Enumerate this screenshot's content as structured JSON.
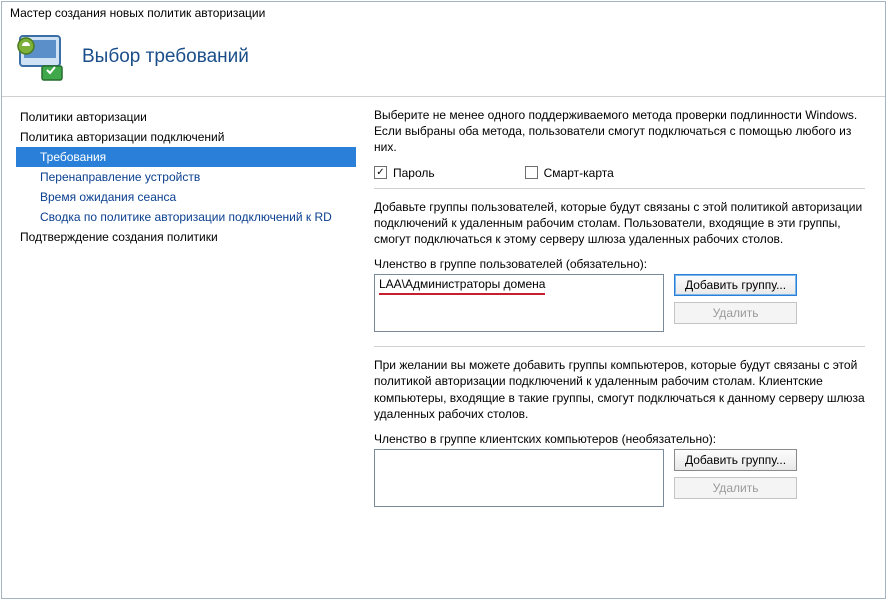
{
  "titlebar": "Мастер создания новых политик авторизации",
  "header": {
    "title": "Выбор требований"
  },
  "nav": {
    "items": [
      {
        "label": "Политики авторизации",
        "sub": false
      },
      {
        "label": "Политика авторизации подключений",
        "sub": false
      },
      {
        "label": "Требования",
        "sub": true,
        "selected": true
      },
      {
        "label": "Перенаправление устройств",
        "sub": true
      },
      {
        "label": "Время ожидания сеанса",
        "sub": true
      },
      {
        "label": "Сводка по политике авторизации подключений к RD",
        "sub": true
      },
      {
        "label": "Подтверждение создания политики",
        "sub": false
      }
    ]
  },
  "content": {
    "intro": "Выберите не менее одного поддерживаемого метода проверки подлинности Windows. Если выбраны оба метода, пользователи смогут подключаться с помощью любого из них.",
    "checkbox_password": "Пароль",
    "checkbox_smartcard": "Смарт-карта",
    "users_section_text": "Добавьте группы пользователей, которые будут связаны с этой политикой авторизации подключений к удаленным рабочим столам. Пользователи, входящие в эти группы, смогут подключаться к этому серверу шлюза удаленных рабочих столов.",
    "users_label": "Членство в группе пользователей (обязательно):",
    "users_entry": "LAA\\Администраторы домена",
    "computers_section_text": "При желании вы можете добавить группы компьютеров, которые будут связаны с этой политикой авторизации подключений к удаленным рабочим столам. Клиентские компьютеры, входящие в такие группы, смогут подключаться к данному серверу шлюза удаленных рабочих столов.",
    "computers_label": "Членство в группе клиентских компьютеров (необязательно):",
    "btn_add_group": "Добавить группу...",
    "btn_remove": "Удалить"
  }
}
